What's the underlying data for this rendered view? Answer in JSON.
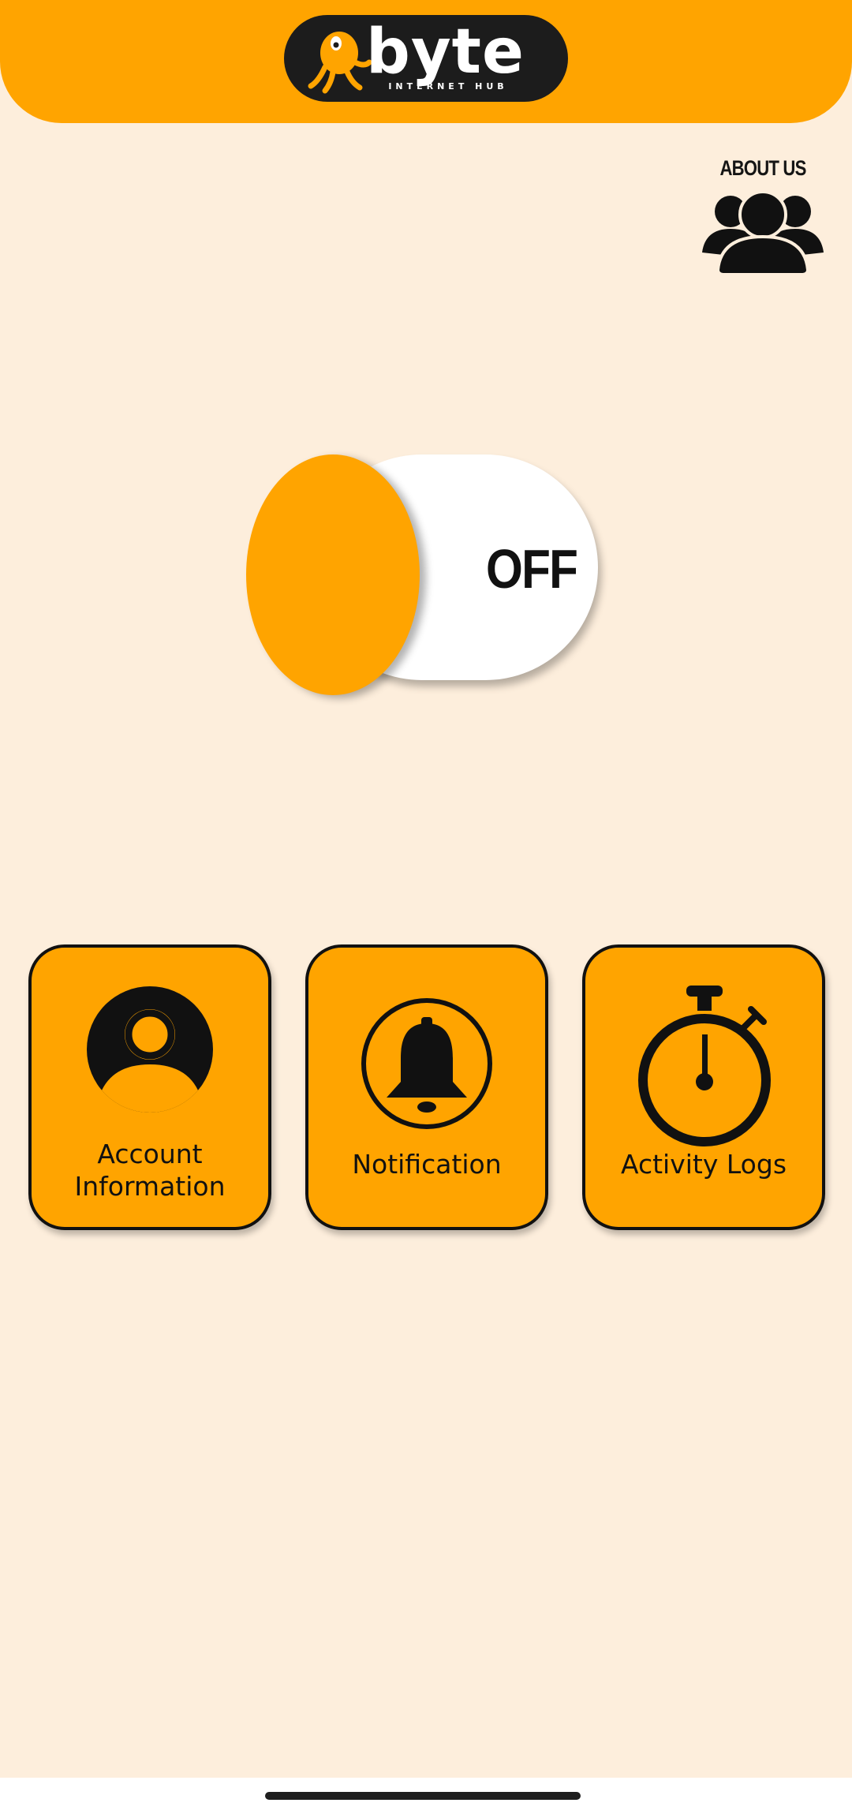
{
  "header": {
    "logo": {
      "brand": "byte",
      "tagline": "INTERNET HUB"
    }
  },
  "about": {
    "label": "ABOUT US",
    "icon": "group-icon"
  },
  "power_toggle": {
    "state_label": "OFF",
    "is_on": false
  },
  "menu": {
    "tiles": [
      {
        "label_line1": "Account",
        "label_line2": "Information",
        "icon": "user-avatar-icon"
      },
      {
        "label": "Notification",
        "icon": "bell-icon"
      },
      {
        "label": "Activity Logs",
        "icon": "stopwatch-icon"
      }
    ]
  },
  "colors": {
    "accent": "#FFA400",
    "background": "#FDEEDC",
    "outline": "#111111"
  }
}
